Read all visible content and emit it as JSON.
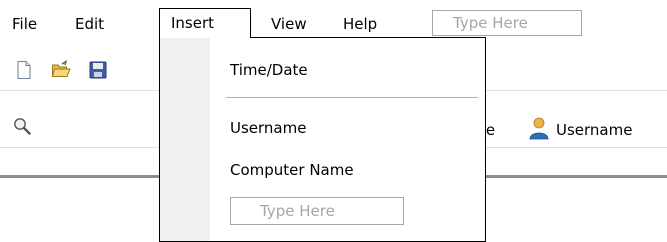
{
  "menubar": {
    "items": [
      {
        "label": "File"
      },
      {
        "label": "Edit"
      },
      {
        "label": "Insert"
      },
      {
        "label": "View"
      },
      {
        "label": "Help"
      }
    ],
    "type_here_placeholder": "Type Here"
  },
  "toolbar": {
    "icons": [
      "new-document-icon",
      "open-folder-icon",
      "save-icon"
    ]
  },
  "toolbar2": {
    "search_icon": "search-icon",
    "partial_date_label": "te",
    "username_label": "Username",
    "user_icon": "user-icon"
  },
  "insert_menu": {
    "items": [
      {
        "label": "Time/Date"
      },
      {
        "label": "Username"
      },
      {
        "label": "Computer Name"
      }
    ],
    "type_here_placeholder": "Type Here"
  },
  "colors": {
    "placeholder_text": "#a6a6a6",
    "gutter": "#f0f0f0",
    "separator_dark": "#8c8c8c"
  }
}
